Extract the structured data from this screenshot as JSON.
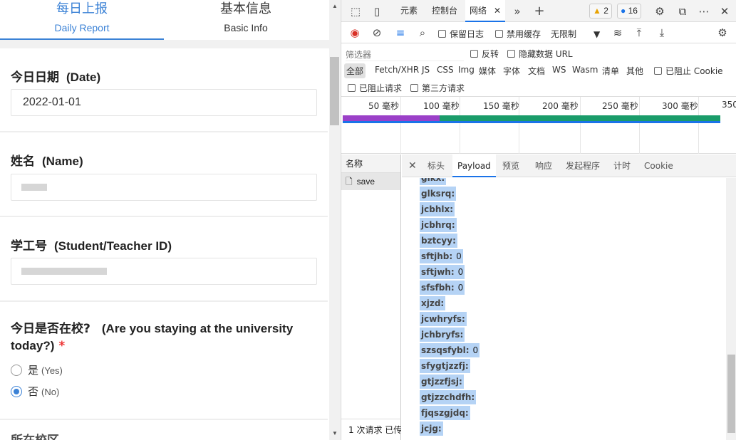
{
  "form": {
    "tabs": [
      {
        "zh": "每日上报",
        "en": "Daily Report"
      },
      {
        "zh": "基本信息",
        "en": "Basic Info"
      }
    ],
    "fields": {
      "date": {
        "label": "今日日期",
        "label_en": "(Date)",
        "value": "2022-01-01"
      },
      "name": {
        "label": "姓名",
        "label_en": "(Name)"
      },
      "id": {
        "label": "学工号",
        "label_en": "(Student/Teacher ID)"
      },
      "staying": {
        "label": "今日是否在校?",
        "label_en_1": "(Are you staying at the university",
        "label_en_2": "today?)",
        "required": "*",
        "options": [
          {
            "zh": "是",
            "en": "(Yes)",
            "selected": false
          },
          {
            "zh": "否",
            "en": "(No)",
            "selected": true
          }
        ]
      },
      "next_label_partial": "所在校区"
    }
  },
  "devtools": {
    "tabs": [
      "元素",
      "控制台",
      "网络",
      "»",
      "+"
    ],
    "active_tab": "网络",
    "warnings": "2",
    "messages": "16",
    "network_toolbar": {
      "preserve_log": "保留日志",
      "disable_cache": "禁用缓存",
      "throttle": "无限制"
    },
    "filter": {
      "placeholder": "筛选器",
      "invert": "反转",
      "hide_data_urls": "隐藏数据 URL",
      "types": [
        "全部",
        "Fetch/XHR",
        "JS",
        "CSS",
        "Img",
        "媒体",
        "字体",
        "文档",
        "WS",
        "Wasm",
        "清单",
        "其他"
      ],
      "blocked_cookies": "已阻止 Cookie",
      "blocked_requests": "已阻止请求",
      "third_party": "第三方请求"
    },
    "timeline": {
      "ticks": [
        "50 毫秒",
        "100 毫秒",
        "150 毫秒",
        "200 毫秒",
        "250 毫秒",
        "300 毫秒",
        "350"
      ]
    },
    "requests": {
      "header": "名称",
      "items": [
        "save"
      ],
      "footer": "1 次请求  已传"
    },
    "detail_tabs": [
      "标头",
      "Payload",
      "预览",
      "响应",
      "发起程序",
      "计时",
      "Cookie"
    ],
    "active_detail_tab": "Payload",
    "payload": [
      {
        "key": "glkx:",
        "value": ""
      },
      {
        "key": "glksrq:",
        "value": ""
      },
      {
        "key": "jcbhlx:",
        "value": ""
      },
      {
        "key": "jcbhrq:",
        "value": ""
      },
      {
        "key": "bztcyy:",
        "value": ""
      },
      {
        "key": "sftjhb:",
        "value": "0"
      },
      {
        "key": "sftjwh:",
        "value": "0"
      },
      {
        "key": "sfsfbh:",
        "value": "0"
      },
      {
        "key": "xjzd:",
        "value": ""
      },
      {
        "key": "jcwhryfs:",
        "value": ""
      },
      {
        "key": "jchbryfs:",
        "value": ""
      },
      {
        "key": "szsqsfybl:",
        "value": "0"
      },
      {
        "key": "sfygtjzzfj:",
        "value": ""
      },
      {
        "key": "gtjzzfjsj:",
        "value": ""
      },
      {
        "key": "gtjzzchdfh:",
        "value": ""
      },
      {
        "key": "fjqszgjdq:",
        "value": ""
      },
      {
        "key": "jcjg:",
        "value": ""
      }
    ]
  }
}
